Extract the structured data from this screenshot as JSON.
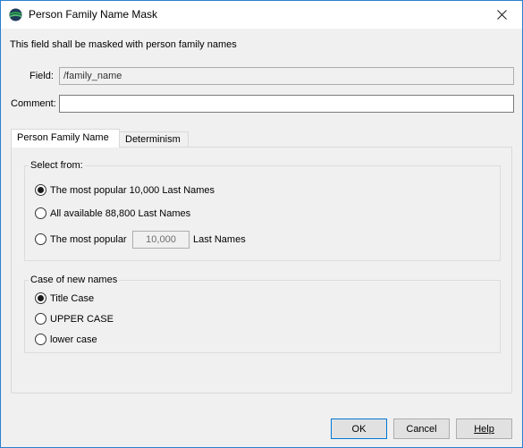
{
  "window": {
    "title": "Person Family Name Mask",
    "icon": "globe-app-icon",
    "close_icon": "close-icon"
  },
  "description": "This field shall be masked with person family names",
  "field": {
    "label": "Field:",
    "value": "/family_name"
  },
  "comment": {
    "label": "Comment:",
    "value": ""
  },
  "tabs": [
    {
      "label": "Person Family Name",
      "selected": true
    },
    {
      "label": "Determinism",
      "selected": false
    }
  ],
  "select_from": {
    "title": "Select from:",
    "options": [
      {
        "label": "The most popular 10,000 Last Names",
        "checked": true
      },
      {
        "label": "All available 88,800 Last Names",
        "checked": false
      },
      {
        "label_before": "The most popular",
        "value": "10,000",
        "label_after": "Last Names",
        "checked": false
      }
    ]
  },
  "case_group": {
    "title": "Case of new names",
    "options": [
      {
        "label": "Title Case",
        "checked": true
      },
      {
        "label": "UPPER CASE",
        "checked": false
      },
      {
        "label": "lower case",
        "checked": false
      }
    ]
  },
  "buttons": {
    "ok": "OK",
    "cancel": "Cancel",
    "help": "Help"
  }
}
